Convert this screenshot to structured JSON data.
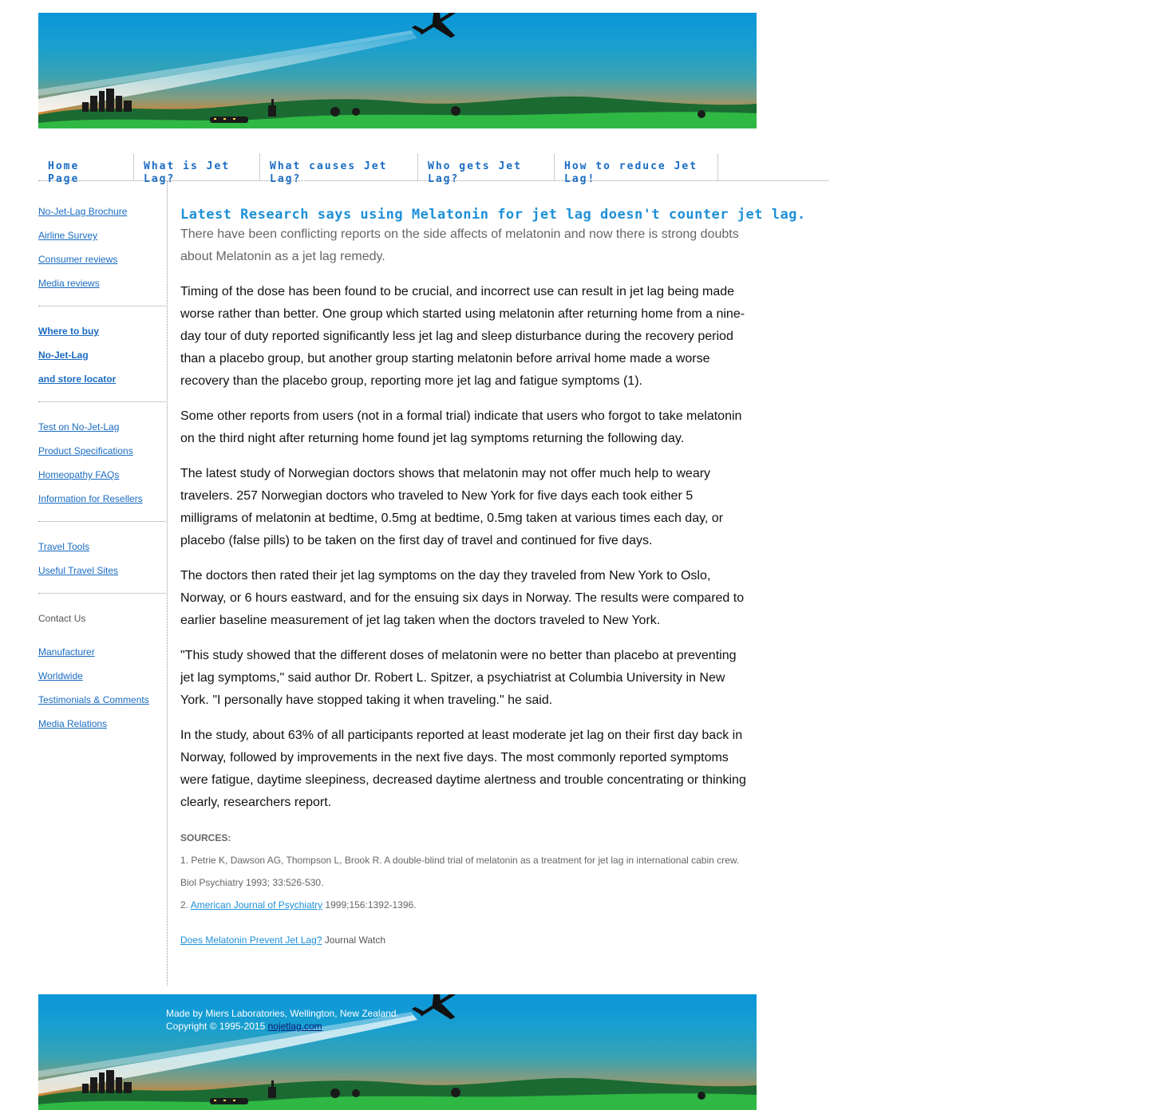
{
  "nav": {
    "items": [
      {
        "line1": "Home",
        "line2": "Page"
      },
      {
        "line1": "What is Jet",
        "line2": "Lag?"
      },
      {
        "line1": "What causes Jet",
        "line2": "Lag?"
      },
      {
        "line1": "Who gets Jet",
        "line2": "Lag?"
      },
      {
        "line1": "How to reduce Jet",
        "line2": "Lag!"
      }
    ]
  },
  "sidebar": {
    "group1": [
      "No-Jet-Lag Brochure",
      "Airline Survey",
      "Consumer reviews",
      "Media reviews"
    ],
    "group2": [
      "Where to buy",
      "No-Jet-Lag",
      "and store locator"
    ],
    "group3": [
      "Test on No-Jet-Lag",
      "Product Specifications",
      "Homeopathy FAQs",
      "Information for Resellers"
    ],
    "group4": [
      "Travel Tools",
      "Useful Travel Sites"
    ],
    "contact_heading": "Contact Us",
    "group5": [
      "Manufacturer",
      "Worldwide",
      "Testimonials & Comments",
      "Media Relations"
    ]
  },
  "article": {
    "headline": "Latest Research says using Melatonin for jet lag doesn't counter jet lag.",
    "intro": "There have been conflicting reports on the side affects of melatonin and now there is strong doubts about Melatonin as a jet lag remedy.",
    "paragraphs": [
      "Timing of the dose has been found to be crucial, and incorrect use can result in jet lag being made worse rather than better. One group which started using melatonin after returning home from a nine-day tour of duty reported significantly less jet lag and sleep disturbance during the recovery period than a placebo group, but another group starting melatonin before arrival home made a worse recovery than the placebo group, reporting more jet lag and fatigue symptoms (1).",
      "Some other reports from users (not in a formal trial) indicate that users who forgot to take melatonin on the third night after returning home found jet lag symptoms returning the following day.",
      "The latest study of Norwegian doctors shows that melatonin may not offer much help to weary travelers. 257 Norwegian doctors who traveled to New York for five days each took either 5 milligrams of melatonin at bedtime, 0.5mg at bedtime, 0.5mg taken at various times each day, or placebo (false pills) to be taken on the first day of travel and continued for five days.",
      "The doctors then rated their jet lag symptoms on the day they traveled from New York to Oslo, Norway, or 6 hours eastward, and for the ensuing six days in Norway. The results were compared to earlier baseline measurement of jet lag taken when the doctors traveled to New York.",
      "\"This study showed that the different doses of melatonin were no better than placebo at preventing jet lag symptoms,\" said author Dr. Robert L. Spitzer, a psychiatrist at Columbia University in New York. \"I personally have stopped taking it when traveling.\" he said.",
      "In the study, about 63% of all participants reported at least moderate jet lag on their first day back in Norway, followed by improvements in the next five days. The most commonly reported symptoms were fatigue, daytime sleepiness, decreased daytime alertness and trouble concentrating or thinking clearly, researchers report."
    ],
    "sources_heading": "SOURCES:",
    "source1": "1. Petrie K, Dawson AG, Thompson L, Brook R. A double-blind trial of melatonin as a treatment for jet lag in international cabin crew. Biol Psychiatry 1993; 33:526-530.",
    "source2_prefix": "2. ",
    "source2_link": "American Journal of Psychiatry",
    "source2_suffix": " 1999;156:1392-1396.",
    "journal_link": "Does Melatonin Prevent Jet Lag?",
    "journal_suffix": " Journal Watch"
  },
  "footer": {
    "line1": "Made by Miers Laboratories, Wellington, New Zealand.",
    "copyright_prefix": "Copyright © 1995-2015 ",
    "site_link": "nojetlag.com"
  }
}
